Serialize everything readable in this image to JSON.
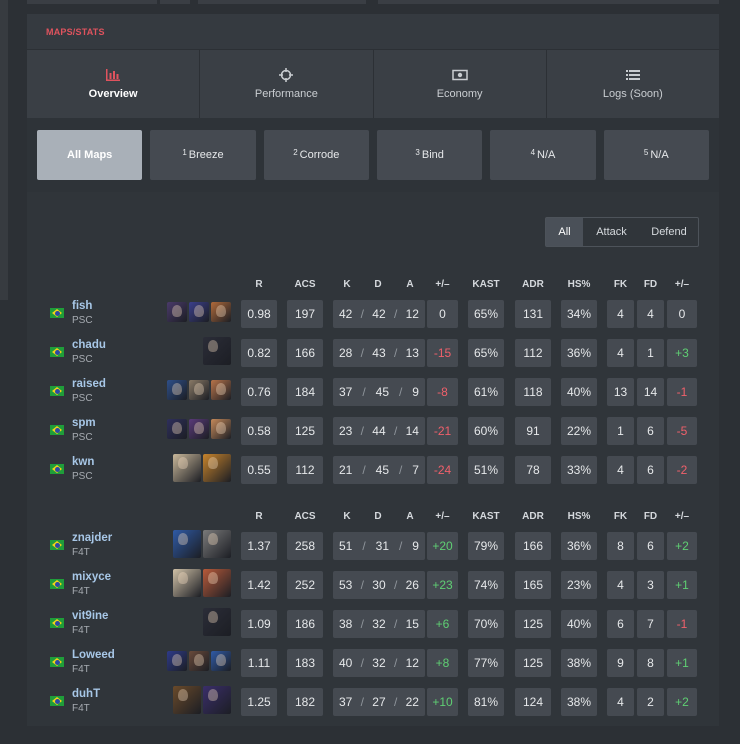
{
  "section_label": "MAPS/STATS",
  "main_tabs": [
    {
      "label": "Overview",
      "icon": "bar-chart-icon",
      "active": true
    },
    {
      "label": "Performance",
      "icon": "crosshair-icon",
      "active": false
    },
    {
      "label": "Economy",
      "icon": "money-icon",
      "active": false
    },
    {
      "label": "Logs (Soon)",
      "icon": "list-icon",
      "active": false
    }
  ],
  "maps": [
    {
      "num": "",
      "name": "All Maps",
      "active": true
    },
    {
      "num": "1",
      "name": "Breeze"
    },
    {
      "num": "2",
      "name": "Corrode"
    },
    {
      "num": "3",
      "name": "Bind"
    },
    {
      "num": "4",
      "name": "N/A"
    },
    {
      "num": "5",
      "name": "N/A"
    }
  ],
  "side_toggle": {
    "all": "All",
    "attack": "Attack",
    "defend": "Defend"
  },
  "headers": {
    "r": "R",
    "acs": "ACS",
    "k": "K",
    "d": "D",
    "a": "A",
    "pm": "+/–",
    "kast": "KAST",
    "adr": "ADR",
    "hs": "HS%",
    "fk": "FK",
    "fd": "FD",
    "fpm": "+/–"
  },
  "teams": [
    {
      "players": [
        {
          "name": "fish",
          "team": "PSC",
          "agents": [
            "#4a3a6a",
            "#3b3f8c",
            "#b06a3a"
          ],
          "r": "0.98",
          "acs": "197",
          "k": "42",
          "d": "42",
          "a": "12",
          "pm": "0",
          "kast": "65%",
          "adr": "131",
          "hs": "34%",
          "fk": "4",
          "fd": "4",
          "fpm": "0"
        },
        {
          "name": "chadu",
          "team": "PSC",
          "agents": [
            "#2b2d38"
          ],
          "r": "0.82",
          "acs": "166",
          "k": "28",
          "d": "43",
          "a": "13",
          "pm": "-15",
          "kast": "65%",
          "adr": "112",
          "hs": "36%",
          "fk": "4",
          "fd": "1",
          "fpm": "+3"
        },
        {
          "name": "raised",
          "team": "PSC",
          "agents": [
            "#2e4f8a",
            "#8a7a66",
            "#b8744a"
          ],
          "r": "0.76",
          "acs": "184",
          "k": "37",
          "d": "45",
          "a": "9",
          "pm": "-8",
          "kast": "61%",
          "adr": "118",
          "hs": "40%",
          "fk": "13",
          "fd": "14",
          "fpm": "-1"
        },
        {
          "name": "spm",
          "team": "PSC",
          "agents": [
            "#2e2f5c",
            "#5a3a7a",
            "#c68a5a"
          ],
          "r": "0.58",
          "acs": "125",
          "k": "23",
          "d": "44",
          "a": "14",
          "pm": "-21",
          "kast": "60%",
          "adr": "91",
          "hs": "22%",
          "fk": "1",
          "fd": "6",
          "fpm": "-5"
        },
        {
          "name": "kwn",
          "team": "PSC",
          "agents": [
            "#c9b89a",
            "#c7842c"
          ],
          "r": "0.55",
          "acs": "112",
          "k": "21",
          "d": "45",
          "a": "7",
          "pm": "-24",
          "kast": "51%",
          "adr": "78",
          "hs": "33%",
          "fk": "4",
          "fd": "6",
          "fpm": "-2"
        }
      ]
    },
    {
      "players": [
        {
          "name": "znajder",
          "team": "F4T",
          "agents": [
            "#2f5aa6",
            "#7a7a7a"
          ],
          "r": "1.37",
          "acs": "258",
          "k": "51",
          "d": "31",
          "a": "9",
          "pm": "+20",
          "kast": "79%",
          "adr": "166",
          "hs": "36%",
          "fk": "8",
          "fd": "6",
          "fpm": "+2"
        },
        {
          "name": "mixyce",
          "team": "F4T",
          "agents": [
            "#d1c2a8",
            "#b85a3a"
          ],
          "r": "1.42",
          "acs": "252",
          "k": "53",
          "d": "30",
          "a": "26",
          "pm": "+23",
          "kast": "74%",
          "adr": "165",
          "hs": "23%",
          "fk": "4",
          "fd": "3",
          "fpm": "+1"
        },
        {
          "name": "vit9ine",
          "team": "F4T",
          "agents": [
            "#2b2d38"
          ],
          "r": "1.09",
          "acs": "186",
          "k": "38",
          "d": "32",
          "a": "15",
          "pm": "+6",
          "kast": "70%",
          "adr": "125",
          "hs": "40%",
          "fk": "6",
          "fd": "7",
          "fpm": "-1"
        },
        {
          "name": "Loweed",
          "team": "F4T",
          "agents": [
            "#2e3a8a",
            "#6a4a3a",
            "#2f5aa6"
          ],
          "r": "1.11",
          "acs": "183",
          "k": "40",
          "d": "32",
          "a": "12",
          "pm": "+8",
          "kast": "77%",
          "adr": "125",
          "hs": "38%",
          "fk": "9",
          "fd": "8",
          "fpm": "+1"
        },
        {
          "name": "duhT",
          "team": "F4T",
          "agents": [
            "#6a4a2a",
            "#3a2e6a"
          ],
          "r": "1.25",
          "acs": "182",
          "k": "37",
          "d": "27",
          "a": "22",
          "pm": "+10",
          "kast": "81%",
          "adr": "124",
          "hs": "38%",
          "fk": "4",
          "fd": "2",
          "fpm": "+2"
        }
      ]
    }
  ]
}
